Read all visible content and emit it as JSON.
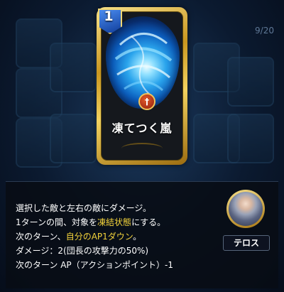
{
  "background": {
    "counter": "9/20"
  },
  "card": {
    "cost": "1",
    "name": "凍てつく嵐",
    "type_icon": "sword-icon",
    "element_color": "#2aa4ec"
  },
  "description": {
    "lines": [
      [
        {
          "text": "選択した敵と左右の敵にダメージ。",
          "hl": false
        }
      ],
      [
        {
          "text": "1ターンの間、対象を",
          "hl": false
        },
        {
          "text": "凍結状態",
          "hl": true
        },
        {
          "text": "にする。",
          "hl": false
        }
      ],
      [
        {
          "text": "次のターン、",
          "hl": false
        },
        {
          "text": "自分のAP1ダウン",
          "hl": true
        },
        {
          "text": "。",
          "hl": false
        }
      ],
      [
        {
          "text": "ダメージ：2(団長の攻撃力の50%)",
          "hl": false
        }
      ],
      [
        {
          "text": "次のターン AP（アクションポイント）-1",
          "hl": false
        }
      ]
    ],
    "highlight_color": "#f2d23b"
  },
  "character": {
    "name": "テロス"
  }
}
